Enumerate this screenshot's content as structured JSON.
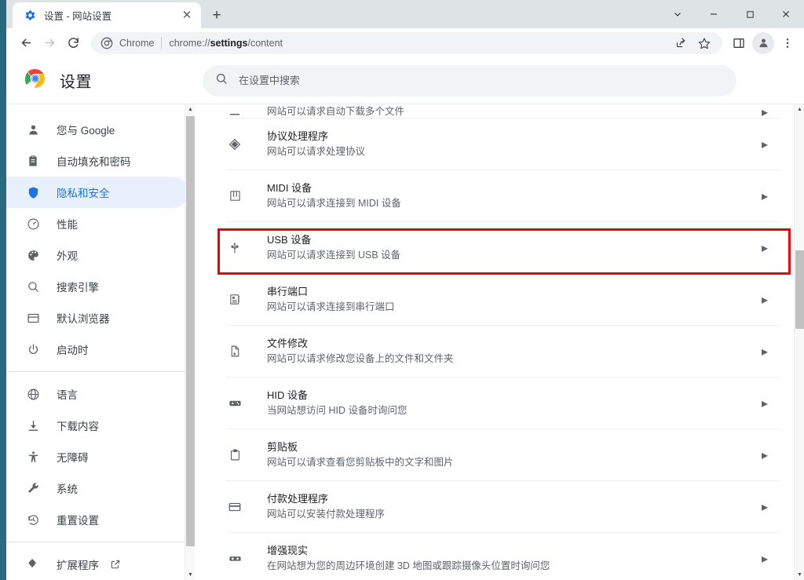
{
  "window": {
    "controls": [
      {
        "name": "tab-search",
        "glyph": "∨"
      },
      {
        "name": "minimize",
        "glyph": "—"
      },
      {
        "name": "maximize",
        "glyph": "□"
      },
      {
        "name": "close",
        "glyph": "✕"
      }
    ]
  },
  "tab": {
    "title": "设置 - 网站设置",
    "favicon": "gear-icon",
    "close_glyph": "✕",
    "new_tab_glyph": "+"
  },
  "toolbar": {
    "back_glyph": "←",
    "forward_glyph": "→",
    "reload_glyph": "⟳",
    "omnibox": {
      "scheme_label": "Chrome",
      "url_prefix": "chrome://",
      "url_bold": "settings",
      "url_suffix": "/content"
    },
    "actions": [
      "share-icon",
      "bookmark-star-icon",
      "side-panel-icon",
      "profile-avatar",
      "more-menu-icon"
    ]
  },
  "settings_header": {
    "title": "设置",
    "search_placeholder": "在设置中搜索",
    "search_value": ""
  },
  "sidebar": {
    "items": [
      {
        "label": "您与 Google",
        "icon": "person-icon",
        "active": false
      },
      {
        "label": "自动填充和密码",
        "icon": "clipboard-key-icon",
        "active": false
      },
      {
        "label": "隐私和安全",
        "icon": "shield-icon",
        "active": true
      },
      {
        "label": "性能",
        "icon": "speedometer-icon",
        "active": false
      },
      {
        "label": "外观",
        "icon": "palette-icon",
        "active": false
      },
      {
        "label": "搜索引擎",
        "icon": "search-icon",
        "active": false
      },
      {
        "label": "默认浏览器",
        "icon": "browser-window-icon",
        "active": false
      },
      {
        "label": "启动时",
        "icon": "power-icon",
        "active": false
      }
    ],
    "items2": [
      {
        "label": "语言",
        "icon": "globe-icon",
        "active": false
      },
      {
        "label": "下载内容",
        "icon": "download-icon",
        "active": false
      },
      {
        "label": "无障碍",
        "icon": "accessibility-icon",
        "active": false
      },
      {
        "label": "系统",
        "icon": "wrench-icon",
        "active": false
      },
      {
        "label": "重置设置",
        "icon": "history-restore-icon",
        "active": false
      }
    ],
    "items3": [
      {
        "label": "扩展程序",
        "icon": "puzzle-icon",
        "external": true,
        "active": false
      }
    ]
  },
  "content": {
    "partial_top_row": {
      "sub": "网站可以请求自动下载多个文件",
      "icon": "download-multiple-icon"
    },
    "rows": [
      {
        "title": "协议处理程序",
        "sub": "网站可以请求处理协议",
        "icon": "protocol-diamond-icon",
        "highlighted": false
      },
      {
        "title": "MIDI 设备",
        "sub": "网站可以请求连接到 MIDI 设备",
        "icon": "piano-keys-icon",
        "highlighted": false
      },
      {
        "title": "USB 设备",
        "sub": "网站可以请求连接到 USB 设备",
        "icon": "usb-icon",
        "highlighted": true
      },
      {
        "title": "串行端口",
        "sub": "网站可以请求连接到串行端口",
        "icon": "serial-chip-icon",
        "highlighted": false
      },
      {
        "title": "文件修改",
        "sub": "网站可以请求修改您设备上的文件和文件夹",
        "icon": "file-edit-icon",
        "highlighted": false
      },
      {
        "title": "HID 设备",
        "sub": "当网站想访问 HID 设备时询问您",
        "icon": "gamepad-icon",
        "highlighted": false
      },
      {
        "title": "剪贴板",
        "sub": "网站可以请求查看您剪贴板中的文字和图片",
        "icon": "clipboard-icon",
        "highlighted": false
      },
      {
        "title": "付款处理程序",
        "sub": "网站可以安装付款处理程序",
        "icon": "credit-card-icon",
        "highlighted": false
      },
      {
        "title": "增强现实",
        "sub": "在网站想为您的周边环境创建 3D 地图或跟踪摄像头位置时询问您",
        "icon": "vr-goggles-icon",
        "highlighted": false
      }
    ],
    "row_arrow_glyph": "▸"
  },
  "annotation": {
    "target": "USB 设备",
    "box_color": "#ee0000"
  },
  "colors": {
    "accent": "#1a73e8",
    "active_pill": "#e8f0fe",
    "desktop": "#2d7187",
    "tabstrip": "#dee3e6"
  }
}
